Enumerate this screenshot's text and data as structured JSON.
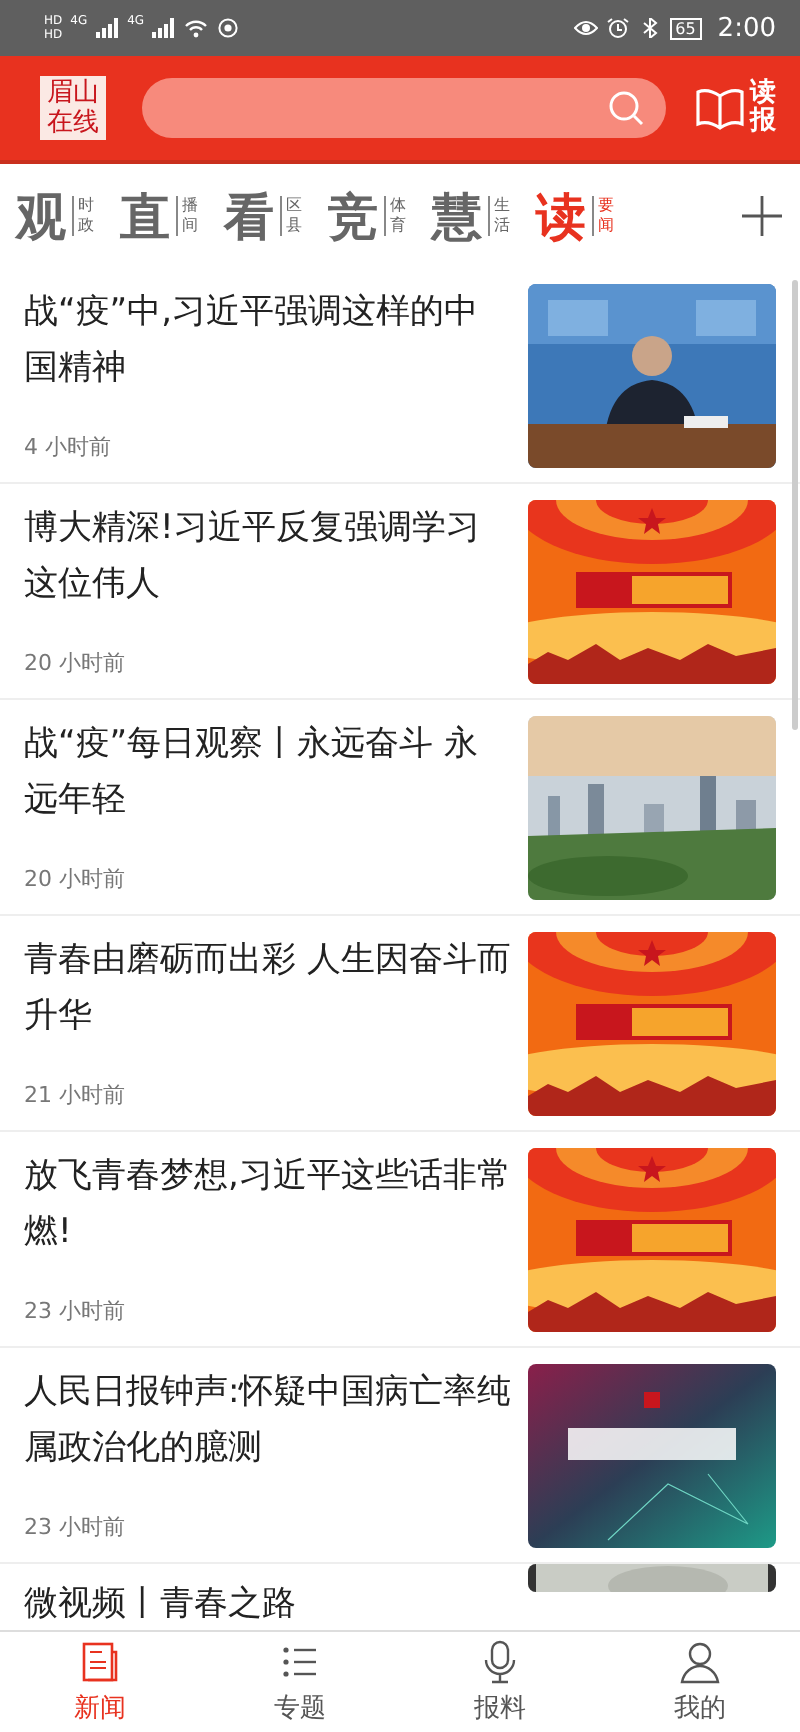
{
  "status_bar": {
    "hd_labels": [
      "HD",
      "HD"
    ],
    "network_labels": [
      "4G",
      "4G"
    ],
    "battery": "65",
    "time": "2:00"
  },
  "header": {
    "logo": "眉山在线",
    "read_paper": "读报"
  },
  "channels": [
    {
      "main": "观",
      "sub": "时政",
      "selected": false
    },
    {
      "main": "直",
      "sub": "播间",
      "selected": false
    },
    {
      "main": "看",
      "sub": "区县",
      "selected": false
    },
    {
      "main": "竞",
      "sub": "体育",
      "selected": false
    },
    {
      "main": "慧",
      "sub": "生活",
      "selected": false
    },
    {
      "main": "读",
      "sub": "要闻",
      "selected": true
    }
  ],
  "articles": [
    {
      "title": "战“疫”中,习近平强调这样的中国精神",
      "time": "4 小时前",
      "image": {
        "kind": "meeting"
      }
    },
    {
      "title": "博大精深!习近平反复强调学习这位伟人",
      "time": "20 小时前",
      "image": {
        "kind": "banner"
      }
    },
    {
      "title": "战“疫”每日观察丨永远奋斗 永远年轻",
      "time": "20 小时前",
      "image": {
        "kind": "city"
      }
    },
    {
      "title": "青春由磨砺而出彩 人生因奋斗而升华",
      "time": "21 小时前",
      "image": {
        "kind": "banner"
      }
    },
    {
      "title": "放飞青春梦想,习近平这些话非常燃!",
      "time": "23 小时前",
      "image": {
        "kind": "banner"
      }
    },
    {
      "title": "人民日报钟声:怀疑中国病亡率纯属政治化的臆测",
      "time": "23 小时前",
      "image": {
        "kind": "gradient"
      }
    },
    {
      "title": "微视频丨青春之路",
      "image": {
        "kind": "sketch"
      }
    }
  ],
  "tab_bar": [
    {
      "label": "新闻",
      "kind": "news",
      "selected": true
    },
    {
      "label": "专题",
      "kind": "list",
      "selected": false
    },
    {
      "label": "报料",
      "kind": "mic",
      "selected": false
    },
    {
      "label": "我的",
      "kind": "person",
      "selected": false
    }
  ]
}
